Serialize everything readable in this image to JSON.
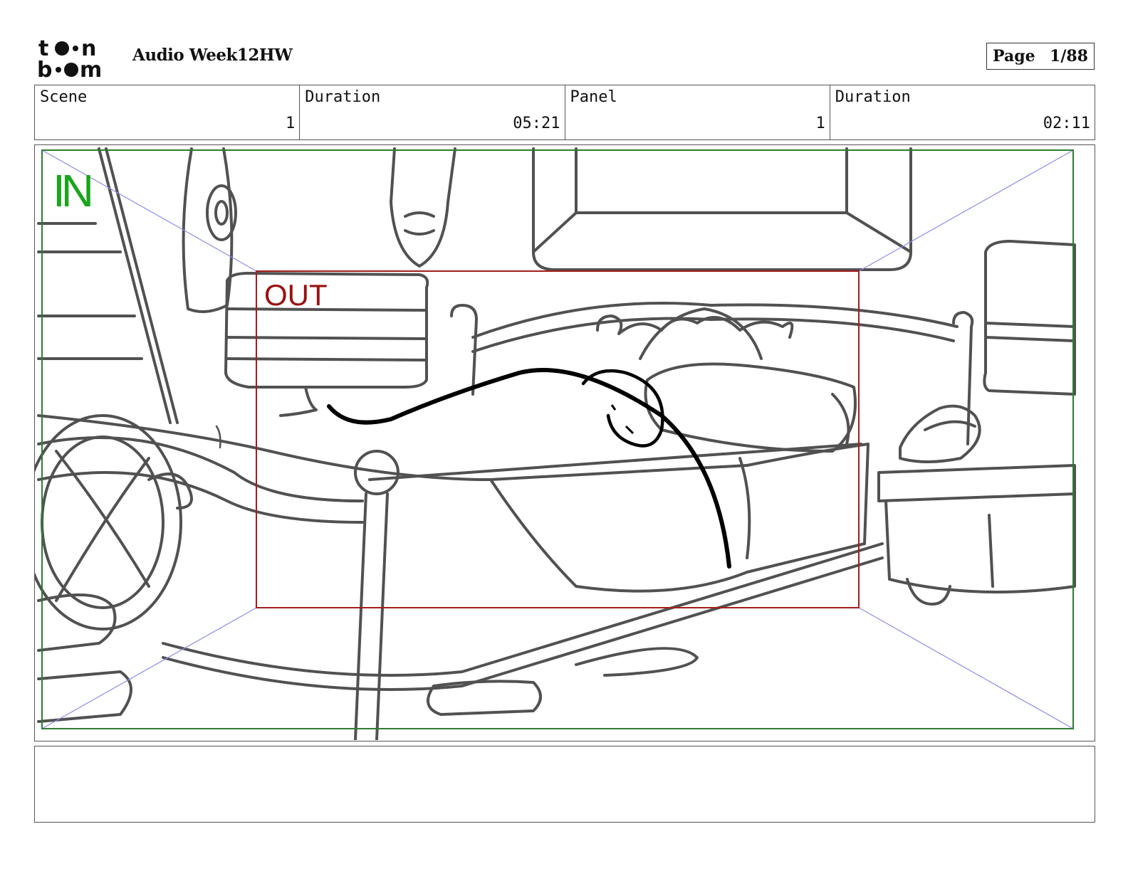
{
  "header": {
    "logo_text": "toon boom",
    "title": "Audio Week12HW",
    "page_label": "Page",
    "page_value": "1/88"
  },
  "info": {
    "scene_label": "Scene",
    "scene_value": "1",
    "scene_duration_label": "Duration",
    "scene_duration_value": "05:21",
    "panel_label": "Panel",
    "panel_value": "1",
    "panel_duration_label": "Duration",
    "panel_duration_value": "02:11"
  },
  "panel": {
    "in_label": "IN",
    "out_label": "OUT",
    "in_frame_color": "#2e7d32",
    "out_frame_color": "#a51c1c",
    "guide_color": "#8c8cf0"
  },
  "notes": {
    "text": ""
  }
}
